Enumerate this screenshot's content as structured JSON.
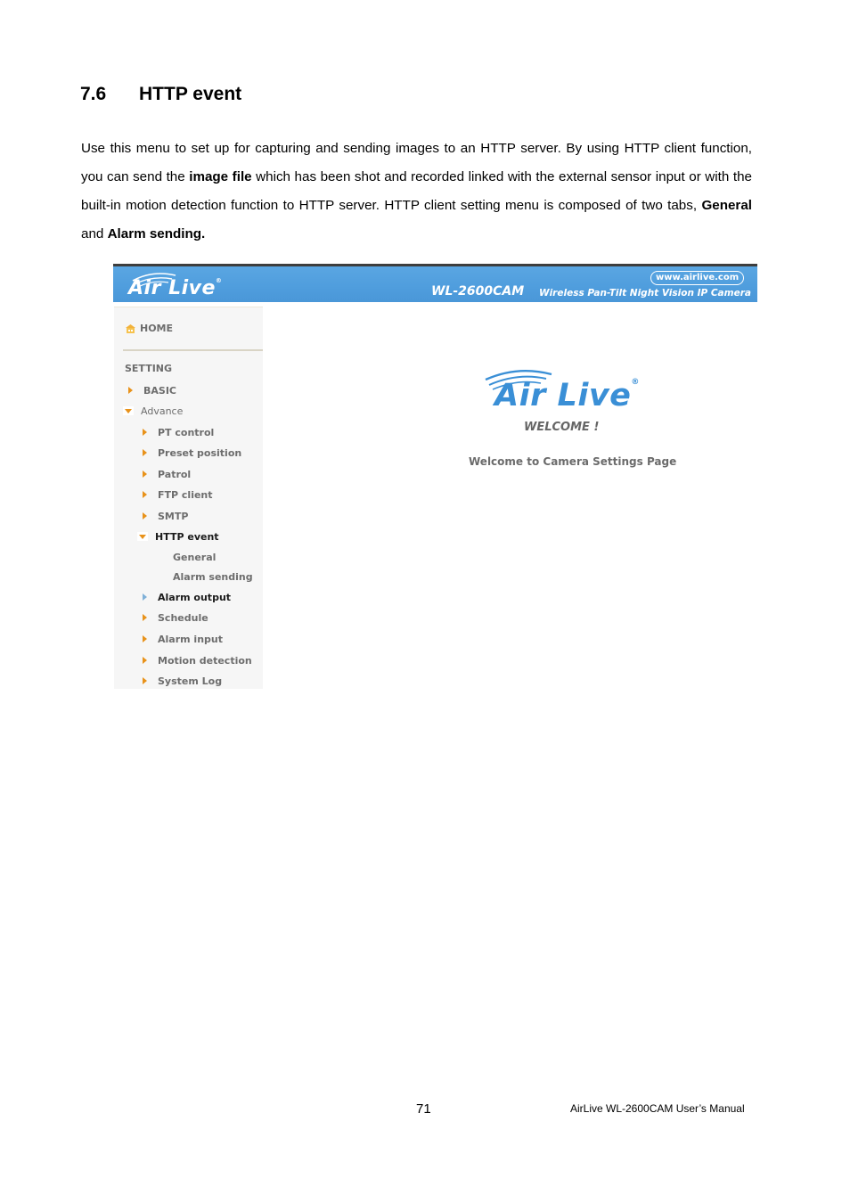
{
  "section": {
    "number": "7.6",
    "title": "HTTP event"
  },
  "intro": {
    "part1": "Use this menu to set up for capturing and sending images to an HTTP server. By using HTTP client function, you can send the ",
    "bold1": "image file",
    "part2": " which has been shot and recorded linked with the external sensor input or with the built-in motion detection function to HTTP server. HTTP client setting menu is composed of two tabs, ",
    "bold2": "General",
    "part3": " and ",
    "bold3": "Alarm sending."
  },
  "screenshot": {
    "banner": {
      "logo": "Air Live",
      "model": "WL-2600CAM",
      "tagline": "Wireless Pan-Tilt Night Vision IP Camera",
      "url": "www.airlive.com",
      "color": "#4f9ddd"
    },
    "sidebar": {
      "home": "HOME",
      "setting": "SETTING",
      "items": [
        {
          "label": "BASIC",
          "level": 0,
          "state": "collapsed"
        },
        {
          "label": "Advance",
          "level": 0,
          "state": "expanded"
        },
        {
          "label": "PT control",
          "level": 1,
          "state": "collapsed"
        },
        {
          "label": "Preset position",
          "level": 1,
          "state": "collapsed"
        },
        {
          "label": "Patrol",
          "level": 1,
          "state": "collapsed"
        },
        {
          "label": "FTP client",
          "level": 1,
          "state": "collapsed"
        },
        {
          "label": "SMTP",
          "level": 1,
          "state": "collapsed"
        },
        {
          "label": "HTTP event",
          "level": 1,
          "state": "expanded"
        },
        {
          "label": "General",
          "level": 2,
          "state": "leaf"
        },
        {
          "label": "Alarm sending",
          "level": 2,
          "state": "leaf"
        },
        {
          "label": "Alarm output",
          "level": 1,
          "state": "hover"
        },
        {
          "label": "Schedule",
          "level": 1,
          "state": "collapsed"
        },
        {
          "label": "Alarm input",
          "level": 1,
          "state": "collapsed"
        },
        {
          "label": "Motion detection",
          "level": 1,
          "state": "collapsed"
        },
        {
          "label": "System Log",
          "level": 1,
          "state": "collapsed"
        }
      ]
    },
    "main": {
      "logo": "Air Live",
      "welcome": "WELCOME !",
      "subtitle": "Welcome to Camera Settings Page"
    }
  },
  "footer": {
    "page_number": "71",
    "manual_title": "AirLive WL-2600CAM User’s Manual"
  }
}
